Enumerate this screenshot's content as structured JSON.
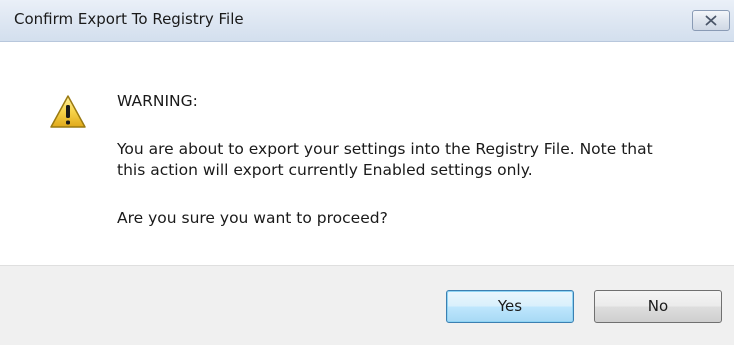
{
  "window": {
    "title": "Confirm Export To Registry File",
    "close_icon": "close-icon"
  },
  "message": {
    "icon": "warning-icon",
    "heading": "WARNING:",
    "body_line_1": "You are about to export your settings into the Registry File. Note that",
    "body_line_2": "this action will export currently Enabled settings only.",
    "question": "Are you sure you want to proceed?"
  },
  "buttons": {
    "yes_label": "Yes",
    "no_label": "No",
    "default": "Yes"
  },
  "colors": {
    "warning_fill": "#f7d34a",
    "footer_bg": "#f0f0f0",
    "default_button_border": "#3c7fb1"
  }
}
